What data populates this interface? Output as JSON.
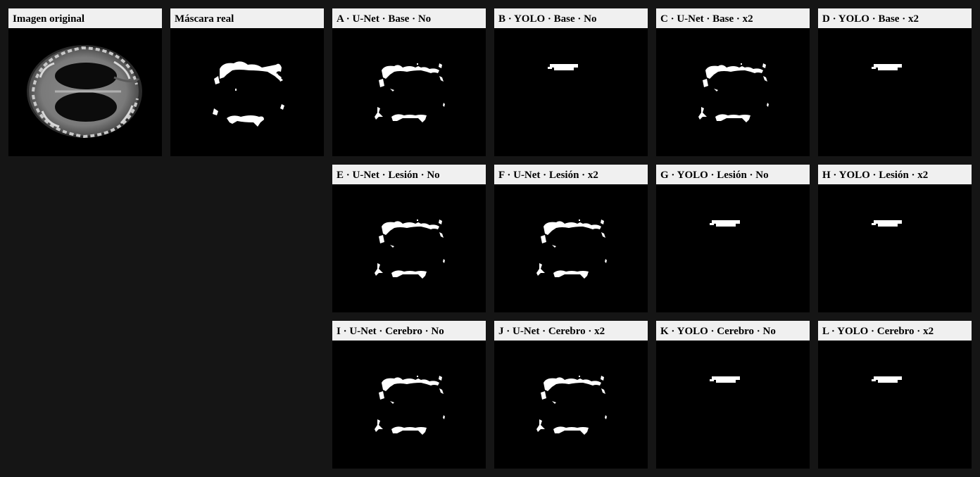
{
  "panels": [
    {
      "id": "original",
      "title": "Imagen original",
      "kind": "mri"
    },
    {
      "id": "mask",
      "title": "Máscara real",
      "kind": "mask"
    },
    {
      "id": "A",
      "title": "A · U-Net · Base · No",
      "kind": "unet"
    },
    {
      "id": "B",
      "title": "B · YOLO · Base · No",
      "kind": "yolo"
    },
    {
      "id": "C",
      "title": "C · U-Net · Base · x2",
      "kind": "unet"
    },
    {
      "id": "D",
      "title": "D · YOLO · Base · x2",
      "kind": "yolo"
    },
    {
      "id": "E",
      "title": "E · U-Net · Lesión · No",
      "kind": "unet"
    },
    {
      "id": "F",
      "title": "F · U-Net · Lesión · x2",
      "kind": "unet"
    },
    {
      "id": "G",
      "title": "G · YOLO · Lesión · No",
      "kind": "yolo"
    },
    {
      "id": "H",
      "title": "H · YOLO · Lesión · x2",
      "kind": "yolo"
    },
    {
      "id": "I",
      "title": "I · U-Net · Cerebro · No",
      "kind": "unet"
    },
    {
      "id": "J",
      "title": "J · U-Net · Cerebro · x2",
      "kind": "unet"
    },
    {
      "id": "K",
      "title": "K · YOLO · Cerebro · No",
      "kind": "yolo"
    },
    {
      "id": "L",
      "title": "L · YOLO · Cerebro · x2",
      "kind": "yolo"
    }
  ]
}
